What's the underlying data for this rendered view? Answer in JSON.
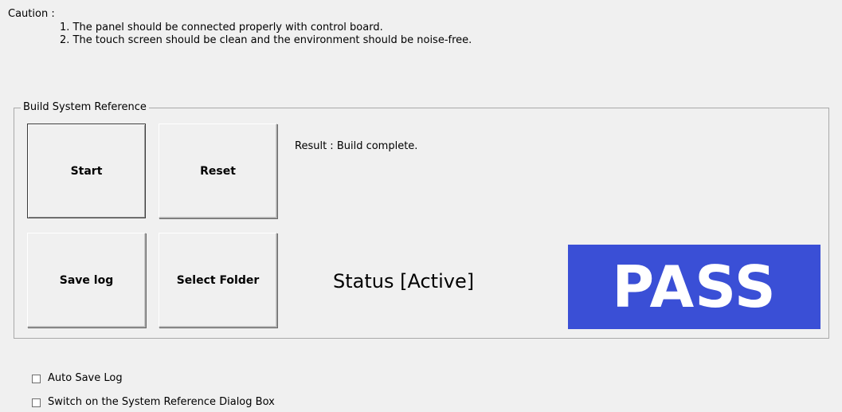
{
  "caution": {
    "title": "Caution :",
    "line1": "1. The panel should be connected properly with control board.",
    "line2": "2. The touch screen should be clean and the environment should be noise-free."
  },
  "group": {
    "legend": "Build System Reference"
  },
  "buttons": {
    "start": "Start",
    "reset": "Reset",
    "save_log": "Save log",
    "select_folder": "Select Folder"
  },
  "result": "Result : Build complete.",
  "status": "Status [Active]",
  "pass_indicator": {
    "text": "PASS",
    "background_color": "#3a4fd6",
    "text_color": "#ffffff"
  },
  "checkboxes": [
    {
      "label": "Auto Save Log",
      "checked": false
    },
    {
      "label": "Switch on the System Reference Dialog Box",
      "checked": false
    }
  ]
}
